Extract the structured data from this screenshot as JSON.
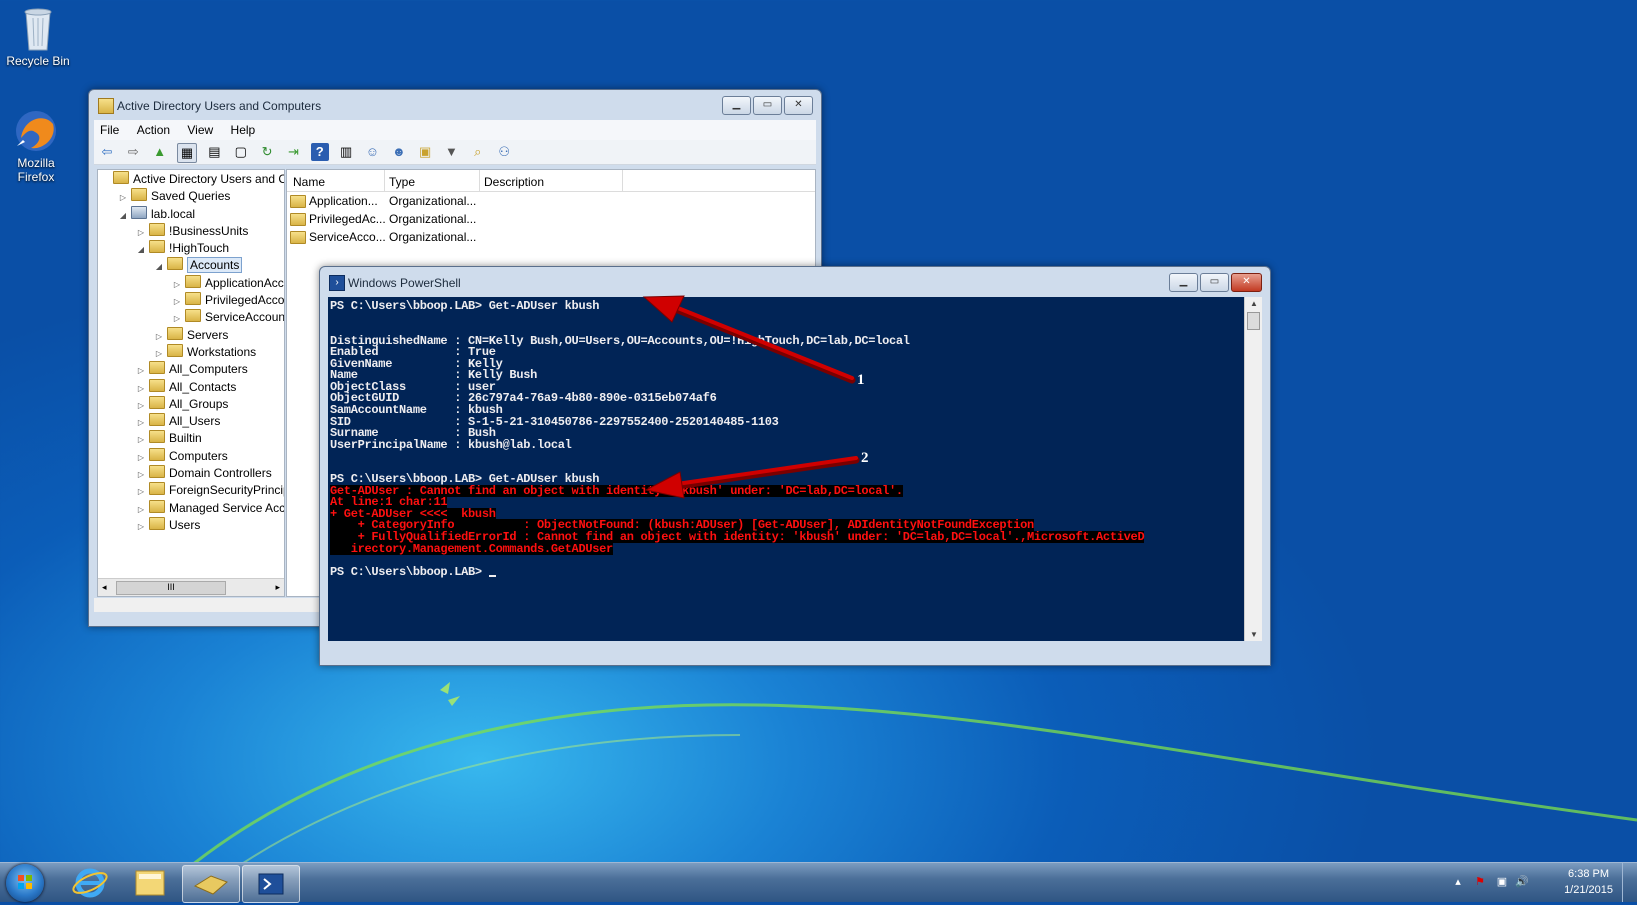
{
  "desktop": {
    "icons": [
      {
        "label": "Recycle Bin"
      },
      {
        "label": "Mozilla Firefox"
      }
    ]
  },
  "aduc": {
    "title": "Active Directory Users and Computers",
    "menu": [
      "File",
      "Action",
      "View",
      "Help"
    ],
    "tree": [
      {
        "label": "Active Directory Users and Com",
        "indent": 0,
        "arrow": "",
        "icon": "aduc-root"
      },
      {
        "label": "Saved Queries",
        "indent": 1,
        "arrow": "▷"
      },
      {
        "label": "lab.local",
        "indent": 1,
        "arrow": "◢",
        "icon": "domain"
      },
      {
        "label": "!BusinessUnits",
        "indent": 2,
        "arrow": "▷"
      },
      {
        "label": "!HighTouch",
        "indent": 2,
        "arrow": "◢"
      },
      {
        "label": "Accounts",
        "indent": 3,
        "arrow": "◢",
        "selected": true
      },
      {
        "label": "ApplicationAccou",
        "indent": 4,
        "arrow": "▷"
      },
      {
        "label": "PrivilegedAccoun",
        "indent": 4,
        "arrow": "▷"
      },
      {
        "label": "ServiceAccounts",
        "indent": 4,
        "arrow": "▷"
      },
      {
        "label": "Servers",
        "indent": 3,
        "arrow": "▷"
      },
      {
        "label": "Workstations",
        "indent": 3,
        "arrow": "▷"
      },
      {
        "label": "All_Computers",
        "indent": 2,
        "arrow": "▷"
      },
      {
        "label": "All_Contacts",
        "indent": 2,
        "arrow": "▷"
      },
      {
        "label": "All_Groups",
        "indent": 2,
        "arrow": "▷"
      },
      {
        "label": "All_Users",
        "indent": 2,
        "arrow": "▷"
      },
      {
        "label": "Builtin",
        "indent": 2,
        "arrow": "▷"
      },
      {
        "label": "Computers",
        "indent": 2,
        "arrow": "▷"
      },
      {
        "label": "Domain Controllers",
        "indent": 2,
        "arrow": "▷"
      },
      {
        "label": "ForeignSecurityPrincipals",
        "indent": 2,
        "arrow": "▷"
      },
      {
        "label": "Managed Service Accour",
        "indent": 2,
        "arrow": "▷"
      },
      {
        "label": "Users",
        "indent": 2,
        "arrow": "▷"
      }
    ],
    "tree_scroll_thumb": "III",
    "list_columns": [
      "Name",
      "Type",
      "Description"
    ],
    "list_rows": [
      {
        "name": "Application...",
        "type": "Organizational...",
        "description": ""
      },
      {
        "name": "PrivilegedAc...",
        "type": "Organizational...",
        "description": ""
      },
      {
        "name": "ServiceAcco...",
        "type": "Organizational...",
        "description": ""
      }
    ]
  },
  "powershell": {
    "title": "Windows PowerShell",
    "lines": [
      {
        "text": "PS C:\\Users\\bboop.LAB> Get-ADUser kbush",
        "kind": "normal"
      },
      {
        "text": "",
        "kind": "normal"
      },
      {
        "text": "",
        "kind": "normal"
      },
      {
        "text": "DistinguishedName : CN=Kelly Bush,OU=Users,OU=Accounts,OU=!HighTouch,DC=lab,DC=local",
        "kind": "normal"
      },
      {
        "text": "Enabled           : True",
        "kind": "normal"
      },
      {
        "text": "GivenName         : Kelly",
        "kind": "normal"
      },
      {
        "text": "Name              : Kelly Bush",
        "kind": "normal"
      },
      {
        "text": "ObjectClass       : user",
        "kind": "normal"
      },
      {
        "text": "ObjectGUID        : 26c797a4-76a9-4b80-890e-0315eb074af6",
        "kind": "normal"
      },
      {
        "text": "SamAccountName    : kbush",
        "kind": "normal"
      },
      {
        "text": "SID               : S-1-5-21-310450786-2297552400-2520140485-1103",
        "kind": "normal"
      },
      {
        "text": "Surname           : Bush",
        "kind": "normal"
      },
      {
        "text": "UserPrincipalName : kbush@lab.local",
        "kind": "normal"
      },
      {
        "text": "",
        "kind": "normal"
      },
      {
        "text": "",
        "kind": "normal"
      },
      {
        "text": "PS C:\\Users\\bboop.LAB> Get-ADUser kbush",
        "kind": "normal"
      },
      {
        "text": "Get-ADUser : Cannot find an object with identity: 'kbush' under: 'DC=lab,DC=local'.",
        "kind": "err"
      },
      {
        "text": "At line:1 char:11",
        "kind": "err"
      },
      {
        "text": "+ Get-ADUser <<<<  kbush",
        "kind": "err"
      },
      {
        "text": "    + CategoryInfo          : ObjectNotFound: (kbush:ADUser) [Get-ADUser], ADIdentityNotFoundException",
        "kind": "err"
      },
      {
        "text": "    + FullyQualifiedErrorId : Cannot find an object with identity: 'kbush' under: 'DC=lab,DC=local'.,Microsoft.ActiveD",
        "kind": "err"
      },
      {
        "text": "   irectory.Management.Commands.GetADUser",
        "kind": "err"
      },
      {
        "text": "",
        "kind": "normal"
      },
      {
        "text": "PS C:\\Users\\bboop.LAB> ",
        "kind": "prompt"
      }
    ]
  },
  "annotations": [
    {
      "label": "1"
    },
    {
      "label": "2"
    }
  ],
  "taskbar": {
    "time": "6:38 PM",
    "date": "1/21/2015"
  },
  "colors": {
    "console_bg": "#012456",
    "console_fg": "#eeedf0",
    "error_fg": "#ff1010",
    "arrow": "#c00000"
  }
}
